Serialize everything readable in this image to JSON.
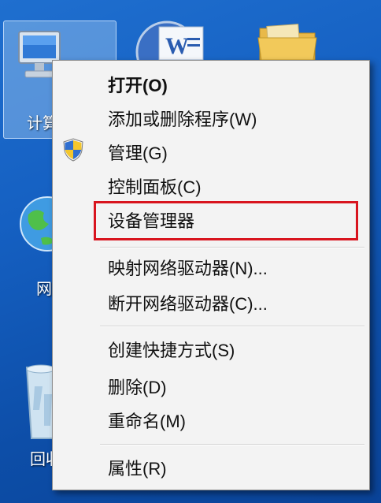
{
  "desktop": {
    "icons": [
      {
        "name": "computer",
        "label": "计算机"
      },
      {
        "name": "network",
        "label": "网络"
      },
      {
        "name": "recycle-bin",
        "label": "回收站"
      }
    ]
  },
  "context_menu": {
    "items": [
      {
        "label": "打开(O)",
        "default": true
      },
      {
        "label": "添加或删除程序(W)"
      },
      {
        "label": "管理(G)",
        "icon": "uac-shield-icon"
      },
      {
        "label": "控制面板(C)"
      },
      {
        "label": "设备管理器",
        "highlighted": true
      },
      {
        "label": "映射网络驱动器(N)..."
      },
      {
        "label": "断开网络驱动器(C)..."
      },
      {
        "label": "创建快捷方式(S)"
      },
      {
        "label": "删除(D)"
      },
      {
        "label": "重命名(M)"
      },
      {
        "label": "属性(R)"
      }
    ],
    "highlight_color": "#d8141e"
  }
}
